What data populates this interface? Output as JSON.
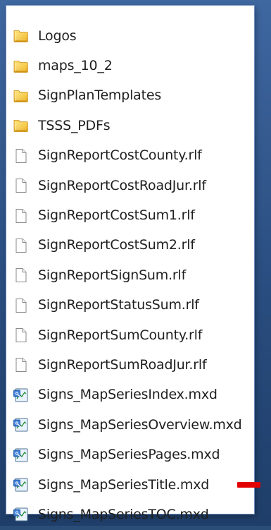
{
  "explorer": {
    "items": [
      {
        "label": "Logos",
        "kind": "folder",
        "icon": "folder-icon"
      },
      {
        "label": "maps_10_2",
        "kind": "folder",
        "icon": "folder-icon"
      },
      {
        "label": "SignPlanTemplates",
        "kind": "folder",
        "icon": "folder-icon"
      },
      {
        "label": "TSSS_PDFs",
        "kind": "folder",
        "icon": "folder-icon"
      },
      {
        "label": "SignReportCostCounty.rlf",
        "kind": "file",
        "icon": "document-icon"
      },
      {
        "label": "SignReportCostRoadJur.rlf",
        "kind": "file",
        "icon": "document-icon"
      },
      {
        "label": "SignReportCostSum1.rlf",
        "kind": "file",
        "icon": "document-icon"
      },
      {
        "label": "SignReportCostSum2.rlf",
        "kind": "file",
        "icon": "document-icon"
      },
      {
        "label": "SignReportSignSum.rlf",
        "kind": "file",
        "icon": "document-icon"
      },
      {
        "label": "SignReportStatusSum.rlf",
        "kind": "file",
        "icon": "document-icon"
      },
      {
        "label": "SignReportSumCounty.rlf",
        "kind": "file",
        "icon": "document-icon"
      },
      {
        "label": "SignReportSumRoadJur.rlf",
        "kind": "file",
        "icon": "document-icon"
      },
      {
        "label": "Signs_MapSeriesIndex.mxd",
        "kind": "map",
        "icon": "mxd-map-icon"
      },
      {
        "label": "Signs_MapSeriesOverview.mxd",
        "kind": "map",
        "icon": "mxd-map-icon"
      },
      {
        "label": "Signs_MapSeriesPages.mxd",
        "kind": "map",
        "icon": "mxd-map-icon"
      },
      {
        "label": "Signs_MapSeriesTitle.mxd",
        "kind": "map",
        "icon": "mxd-map-icon",
        "highlighted": true
      },
      {
        "label": "Signs_MapSeriesTOC.mxd",
        "kind": "map",
        "icon": "mxd-map-icon"
      }
    ],
    "highlight_marker_color": "#e20000",
    "background_color": "#2a4d78",
    "panel_color": "#ffffff"
  }
}
